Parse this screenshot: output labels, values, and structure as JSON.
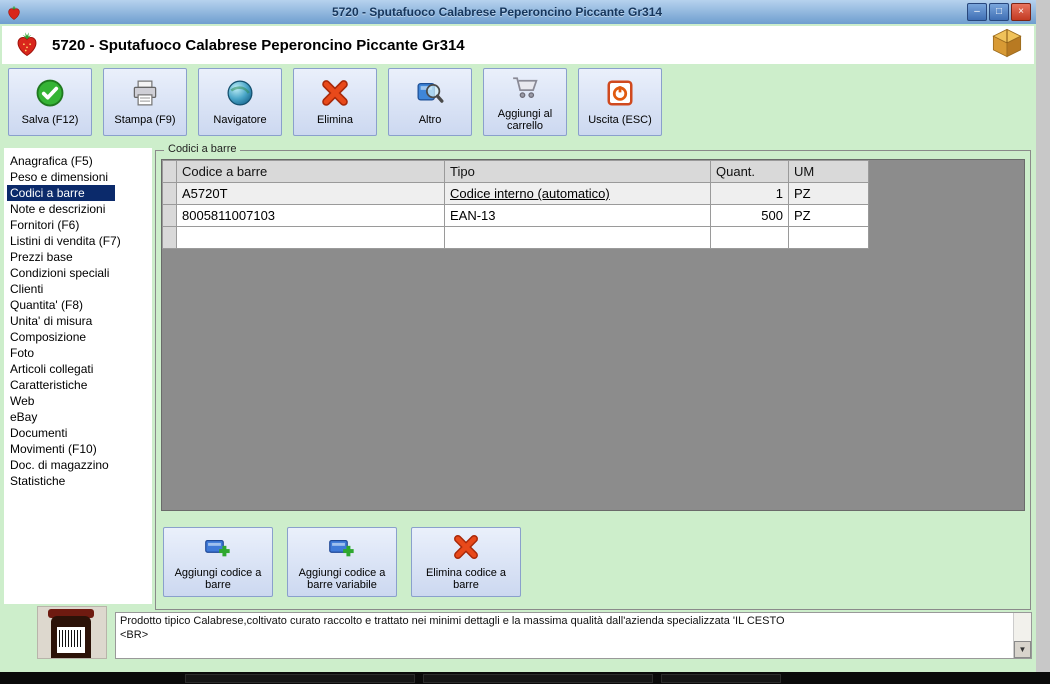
{
  "window": {
    "title": "5720 - Sputafuoco Calabrese Peperoncino Piccante Gr314",
    "controls": {
      "minimize": "–",
      "maximize": "□",
      "close": "×"
    }
  },
  "header": {
    "title": "5720 - Sputafuoco Calabrese Peperoncino Piccante Gr314"
  },
  "toolbar": {
    "buttons": [
      {
        "label": "Salva (F12)",
        "icon": "save-check-icon"
      },
      {
        "label": "Stampa (F9)",
        "icon": "printer-icon"
      },
      {
        "label": "Navigatore",
        "icon": "globe-icon"
      },
      {
        "label": "Elimina",
        "icon": "delete-x-icon"
      },
      {
        "label": "Altro",
        "icon": "magnifier-icon"
      },
      {
        "label": "Aggiungi al carrello",
        "icon": "cart-icon"
      },
      {
        "label": "Uscita (ESC)",
        "icon": "power-icon"
      }
    ]
  },
  "sidebar": {
    "selected_index": 2,
    "items": [
      "Anagrafica (F5)",
      "Peso e dimensioni",
      "Codici a barre",
      "Note e descrizioni",
      "Fornitori (F6)",
      "Listini di vendita (F7)",
      "Prezzi base",
      "Condizioni speciali",
      "Clienti",
      "Quantita' (F8)",
      "Unita' di misura",
      "Composizione",
      "Foto",
      "Articoli collegati",
      "Caratteristiche",
      "Web",
      "eBay",
      "Documenti",
      "Movimenti (F10)",
      "Doc. di magazzino",
      "Statistiche"
    ]
  },
  "main": {
    "groupbox_label": "Codici a barre",
    "table": {
      "columns": [
        "Codice a barre",
        "Tipo",
        "Quant.",
        "UM"
      ],
      "rows": [
        {
          "codice": "A5720T",
          "tipo": "Codice interno (automatico)",
          "quant": "1",
          "um": "PZ"
        },
        {
          "codice": "8005811007103",
          "tipo": "EAN-13",
          "quant": "500",
          "um": "PZ"
        },
        {
          "codice": "",
          "tipo": "",
          "quant": "",
          "um": ""
        }
      ]
    },
    "buttons": [
      {
        "label": "Aggiungi codice a barre",
        "icon": "barcode-add-icon"
      },
      {
        "label": "Aggiungi codice a barre variabile",
        "icon": "barcode-add-icon"
      },
      {
        "label": "Elimina codice a barre",
        "icon": "delete-x-icon"
      }
    ]
  },
  "description": {
    "line1": "Prodotto tipico Calabrese,coltivato curato raccolto e trattato nei minimi dettagli e la massima qualità dall'azienda specializzata 'IL CESTO",
    "line2": "<BR>"
  },
  "scrollbar": {
    "down_arrow": "▼"
  },
  "colors": {
    "window_green": "#cdeecb",
    "titlebar_blue": "#6f9ecf",
    "selected_navy": "#0b2a6b",
    "table_background_gray": "#8c8c8c",
    "button_face": "#ccd8f0"
  }
}
